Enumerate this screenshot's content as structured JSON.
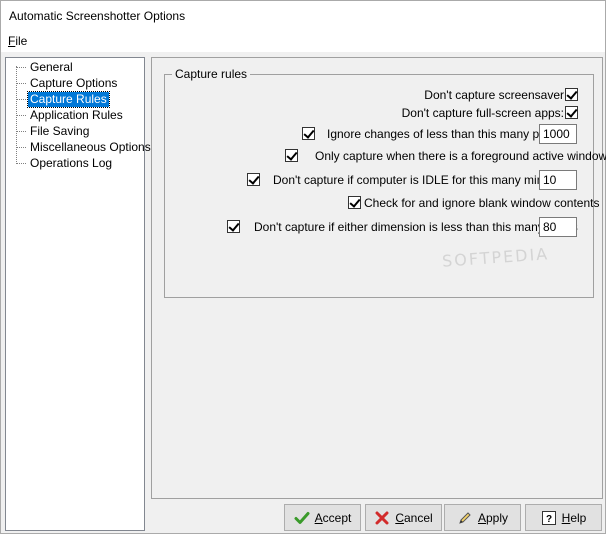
{
  "window": {
    "title": "Automatic Screenshotter Options"
  },
  "menu": {
    "file_label": "File",
    "file_accel": "F",
    "file_rest": "ile"
  },
  "tree": {
    "items": [
      {
        "label": "General"
      },
      {
        "label": "Capture Options"
      },
      {
        "label": "Capture Rules",
        "selected": true
      },
      {
        "label": "Application Rules"
      },
      {
        "label": "File Saving"
      },
      {
        "label": "Miscellaneous Options"
      },
      {
        "label": "Operations Log"
      }
    ]
  },
  "capture_rules": {
    "group_title": "Capture rules",
    "options": [
      {
        "label": "Don't capture screensaver",
        "checked": true
      },
      {
        "label": "Don't capture full-screen apps:",
        "checked": true
      },
      {
        "label": "Ignore changes of less than this many pixels:",
        "checked": true,
        "value": "1000"
      },
      {
        "label": "Only capture when there is a foreground active window",
        "checked": true
      },
      {
        "label": "Don't capture if computer is IDLE for this many minutes:",
        "checked": true,
        "value": "10"
      },
      {
        "label": "Check for and ignore blank window contents",
        "checked": true
      },
      {
        "label": "Don't capture if either dimension is less than this many pixels",
        "checked": true,
        "value": "80"
      }
    ]
  },
  "buttons": {
    "accept": {
      "label": "Accept",
      "accel": "A",
      "rest": "ccept"
    },
    "cancel": {
      "label": "Cancel",
      "accel": "C",
      "rest": "ancel"
    },
    "apply": {
      "label": "Apply",
      "accel": "A",
      "rest": "pply"
    },
    "help": {
      "label": "Help",
      "accel": "H",
      "rest": "elp"
    }
  },
  "colors": {
    "selection": "#0078d7",
    "accept_icon": "#3a9a2a",
    "cancel_icon": "#d22b2b"
  },
  "watermark": "SOFTPEDIA"
}
